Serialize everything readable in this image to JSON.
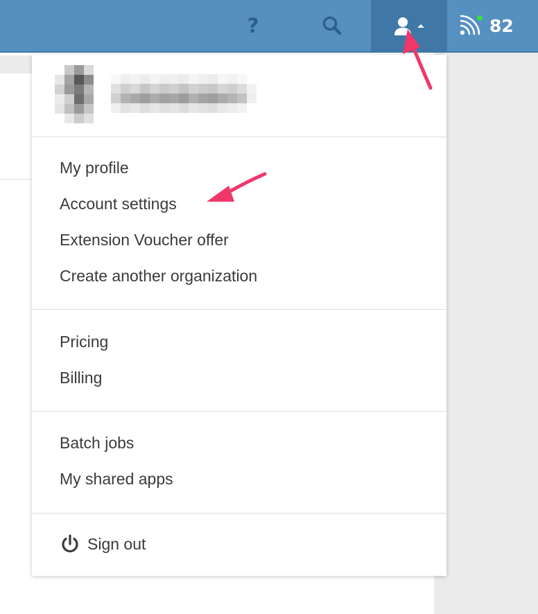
{
  "topbar": {
    "help_glyph": "?",
    "notification_count": "82",
    "icons": {
      "help": "question-mark-icon",
      "search": "search-icon",
      "user": "user-icon",
      "menu_caret": "caret-up-icon",
      "feed": "rss-feed-icon",
      "status": "online-status-dot-icon"
    },
    "colors": {
      "bar": "#5590c1",
      "active": "#3f78a6",
      "dim_icon": "#2b5f8f",
      "status_dot": "#3ddc3d"
    }
  },
  "menu": {
    "sections": [
      {
        "items": [
          {
            "label": "My profile"
          },
          {
            "label": "Account settings"
          },
          {
            "label": "Extension Voucher offer"
          },
          {
            "label": "Create another organization"
          }
        ]
      },
      {
        "items": [
          {
            "label": "Pricing"
          },
          {
            "label": "Billing"
          }
        ]
      },
      {
        "items": [
          {
            "label": "Batch jobs"
          },
          {
            "label": "My shared apps"
          }
        ]
      }
    ],
    "signout": {
      "label": "Sign out",
      "icon": "power-icon"
    }
  },
  "annotations": {
    "arrow_color": "#f0376a"
  }
}
